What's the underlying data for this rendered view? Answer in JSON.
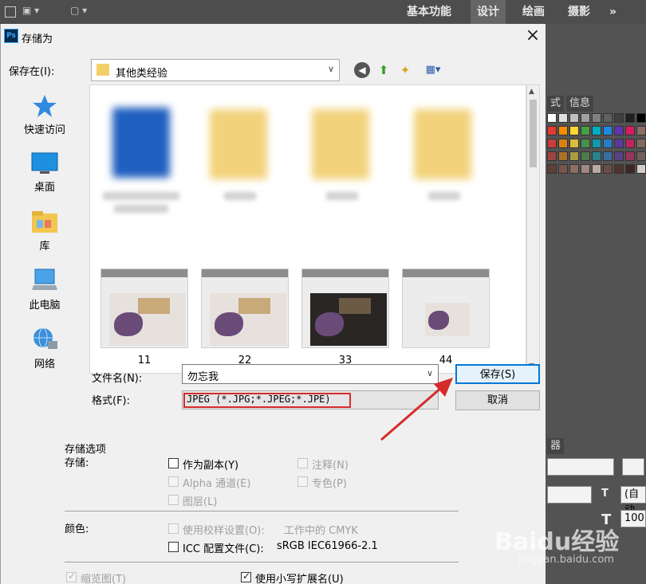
{
  "photoshop": {
    "workspaces": [
      "基本功能",
      "设计",
      "绘画",
      "摄影",
      "»"
    ],
    "panel_tabs": [
      "式",
      "信息"
    ],
    "lower_panel_tab": "器",
    "char_field_auto": "(自动",
    "char_field_pct": "100"
  },
  "dialog": {
    "title": "存储为",
    "app_badge": "Ps",
    "save_in_label": "保存在(I):",
    "save_in_value": "其他类经验",
    "places": [
      "快速访问",
      "桌面",
      "库",
      "此电脑",
      "网络"
    ],
    "thumbnails": [
      {
        "caption": "11"
      },
      {
        "caption": "22"
      },
      {
        "caption": "33"
      },
      {
        "caption": "44"
      }
    ],
    "filename_label": "文件名(N):",
    "filename_value": "勿忘我",
    "format_label": "格式(F):",
    "format_value": "JPEG (*.JPG;*.JPEG;*.JPE)",
    "save_button": "保存(S)",
    "cancel_button": "取消"
  },
  "options": {
    "group_title": "存储选项",
    "save_label": "存储:",
    "as_copy": "作为副本(Y)",
    "notes": "注释(N)",
    "alpha": "Alpha 通道(E)",
    "spot": "专色(P)",
    "layers": "图层(L)",
    "color_label": "颜色:",
    "proof": "使用校样设置(O):",
    "proof_value": "工作中的 CMYK",
    "icc": "ICC 配置文件(C):",
    "icc_value": "sRGB IEC61966-2.1",
    "thumbnail": "缩览图(T)",
    "lowercase_ext": "使用小写扩展名(U)"
  },
  "watermark": {
    "logo": "Baidu经验",
    "url": "jingyan.baidu.com"
  },
  "colors": {
    "accent": "#0078d7",
    "highlight": "#d62b2b"
  }
}
